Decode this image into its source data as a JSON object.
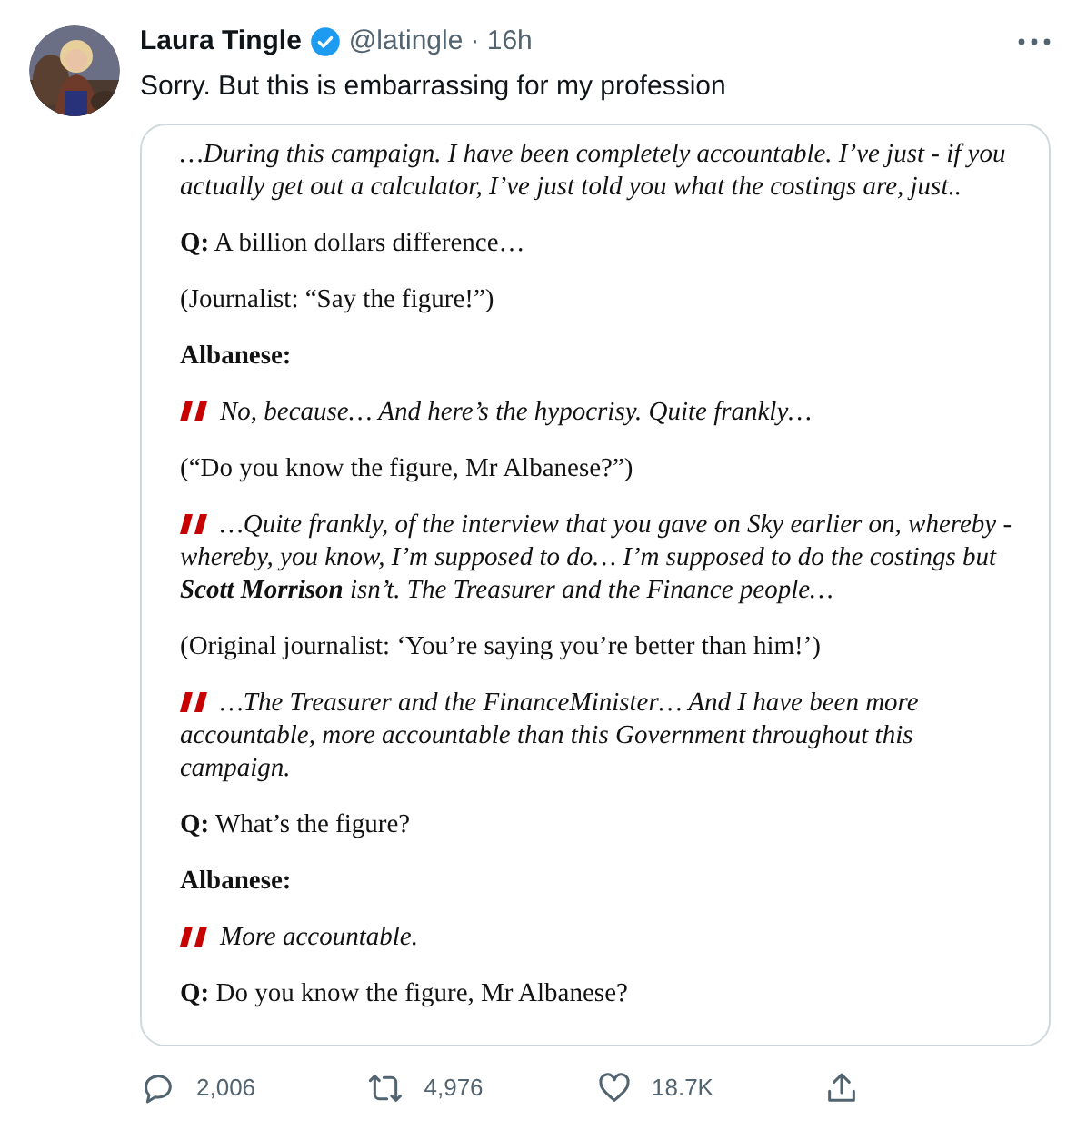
{
  "tweet": {
    "name": "Laura Tingle",
    "verified": true,
    "handle": "@latingle",
    "time": "· 16h",
    "text": "Sorry. But this is embarrassing for my profession"
  },
  "quoted_image": {
    "paragraphs": [
      {
        "kind": "italic",
        "text": "…During this campaign. I have been completely accountable. I’ve just - if you actually get out a calculator, I’ve just told you what the costings are, just.."
      },
      {
        "kind": "plain",
        "text": "**Q:** A billion dollars difference…"
      },
      {
        "kind": "plain",
        "text": "(Journalist: “Say the figure!”)"
      },
      {
        "kind": "speaker",
        "text": "Albanese:"
      },
      {
        "kind": "quote",
        "text": "No, because… And here’s the hypocrisy. Quite frankly…"
      },
      {
        "kind": "plain",
        "text": "(“Do you know the figure, Mr Albanese?”)"
      },
      {
        "kind": "quote",
        "text": "…Quite frankly, of the interview that you gave on Sky earlier on, whereby - whereby, you know, I’m supposed to do… I’m supposed to do the costings but **Scott Morrison** isn’t. The Treasurer and the Finance people…"
      },
      {
        "kind": "plain",
        "text": "(Original journalist: ‘You’re saying you’re better than him!’)"
      },
      {
        "kind": "quote",
        "text": "…The Treasurer and the FinanceMinister… And I have been more accountable, more accountable than this Government throughout this campaign."
      },
      {
        "kind": "plain",
        "text": "**Q:** What’s the figure?"
      },
      {
        "kind": "speaker",
        "text": "Albanese:"
      },
      {
        "kind": "quote",
        "text": "More accountable."
      },
      {
        "kind": "plain",
        "text": "**Q:** Do you know the figure, Mr Albanese?"
      }
    ]
  },
  "actions": [
    {
      "kind": "reply",
      "count": "2,006"
    },
    {
      "kind": "retweet",
      "count": "4,976"
    },
    {
      "kind": "like",
      "count": "18.7K"
    },
    {
      "kind": "share"
    }
  ]
}
